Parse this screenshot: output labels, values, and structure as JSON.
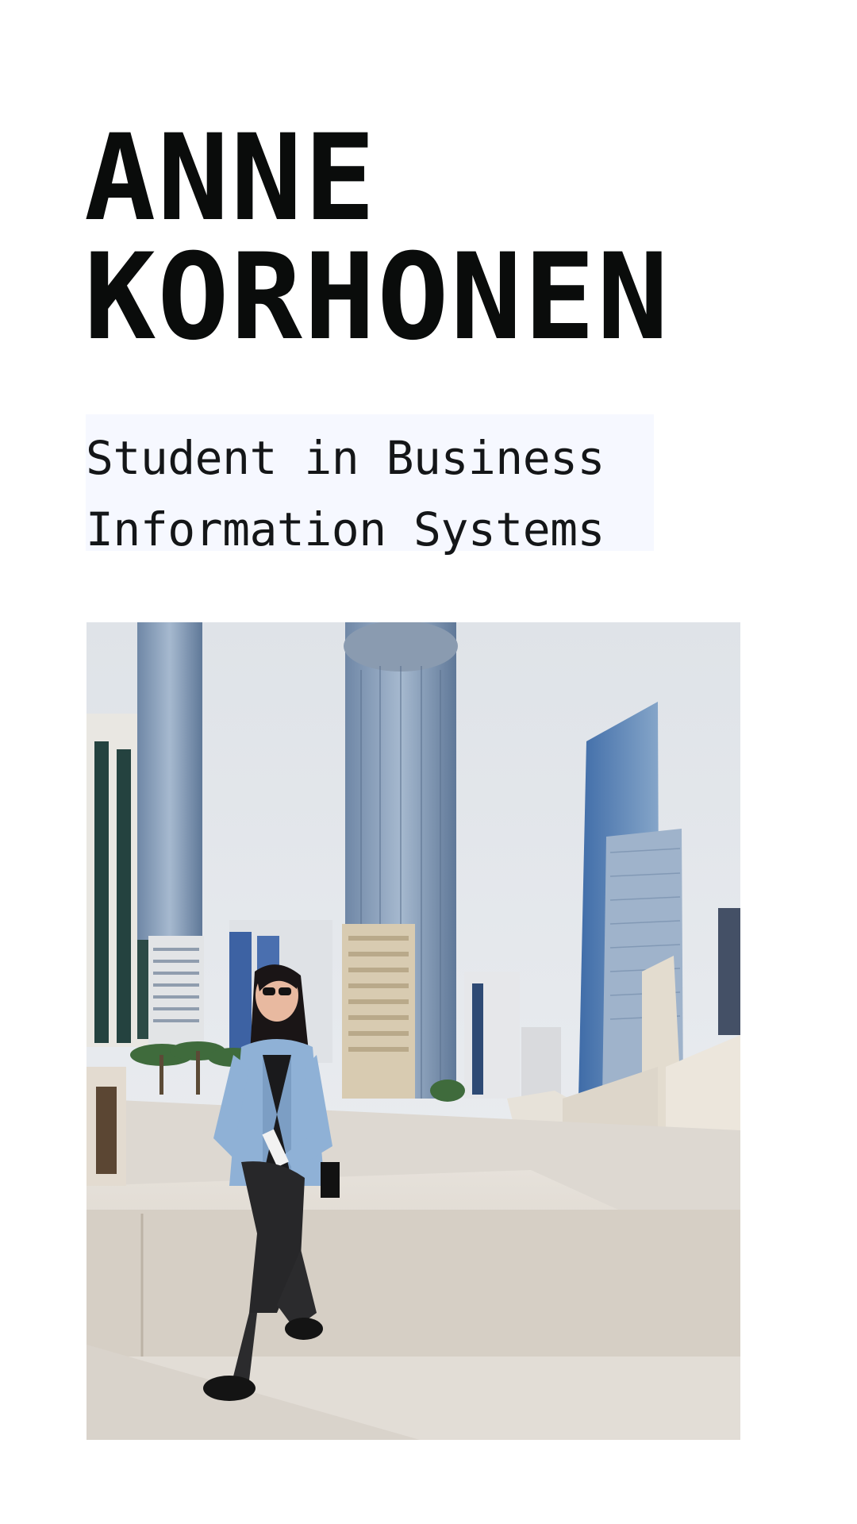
{
  "profile": {
    "first_name": "ANNE",
    "last_name": "KORHONEN",
    "subtitle_line1": "Student in Business",
    "subtitle_line2": "Information Systems"
  },
  "photo": {
    "description_icon": "profile-photo",
    "colors": {
      "sky": "#e3e6ea",
      "glass": "#7f9bbd",
      "stone": "#d9d3ca",
      "jacket": "#8fb1d6"
    }
  }
}
